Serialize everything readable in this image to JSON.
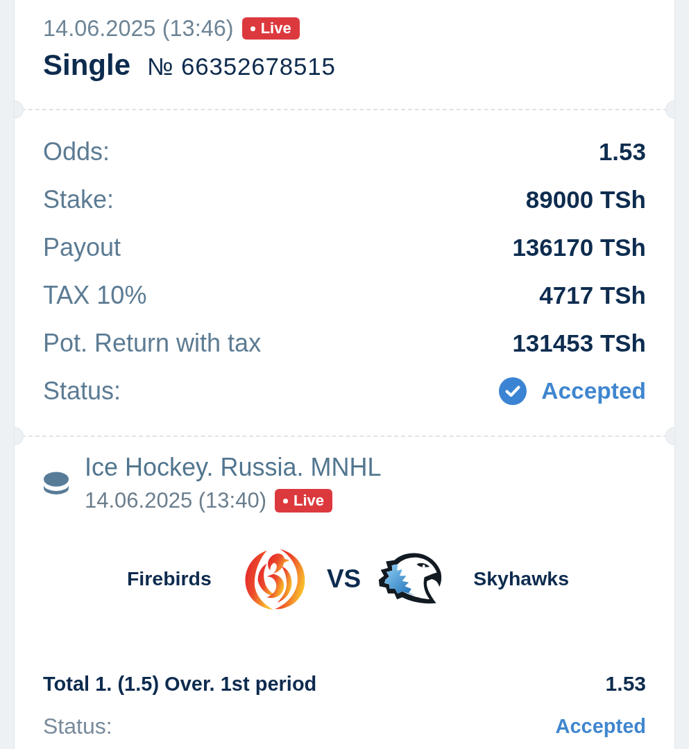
{
  "header": {
    "date": "14.06.2025 (13:46)",
    "badge": "Live",
    "bet_type": "Single",
    "bet_number": "№ 66352678515"
  },
  "summary": [
    {
      "kind": "amount",
      "label": "Odds:",
      "value": "1.53"
    },
    {
      "kind": "amount",
      "label": "Stake:",
      "value": "89000 TSh"
    },
    {
      "kind": "amount",
      "label": "Payout",
      "value": "136170 TSh"
    },
    {
      "kind": "amount",
      "label": "TAX 10%",
      "value": "4717 TSh"
    },
    {
      "kind": "amount",
      "label": "Pot. Return with tax",
      "value": "131453 TSh"
    },
    {
      "kind": "status",
      "label": "Status:",
      "value": "Accepted"
    }
  ],
  "event": {
    "league": "Ice Hockey. Russia. MNHL",
    "date": "14.06.2025 (13:40)",
    "badge": "Live",
    "home_team": "Firebirds",
    "versus": "VS",
    "away_team": "Skyhawks",
    "selection": "Total 1. (1.5) Over. 1st period",
    "odds": "1.53",
    "status_label": "Status:",
    "status": "Accepted"
  }
}
